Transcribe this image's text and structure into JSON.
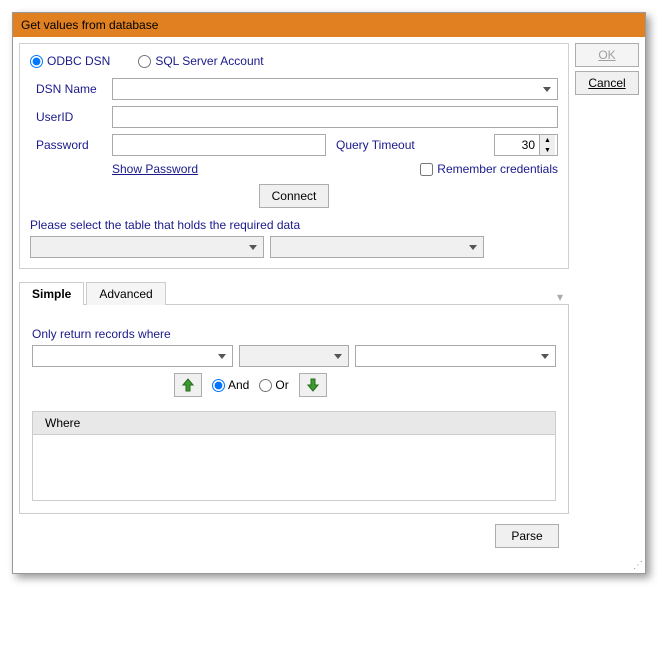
{
  "title": "Get values from database",
  "buttons": {
    "ok": "OK",
    "cancel": "Cancel",
    "connect": "Connect",
    "parse": "Parse"
  },
  "conn": {
    "radio_odbc": "ODBC DSN",
    "radio_sql": "SQL Server Account",
    "dsn_label": "DSN Name",
    "userid_label": "UserID",
    "password_label": "Password",
    "query_timeout_label": "Query Timeout",
    "query_timeout_value": "30",
    "show_password": "Show Password",
    "remember": "Remember credentials"
  },
  "table_select_label": "Please select the table that holds the required data",
  "tabs": {
    "simple": "Simple",
    "advanced": "Advanced"
  },
  "filter": {
    "only_return": "Only return records where",
    "and": "And",
    "or": "Or",
    "where_header": "Where"
  }
}
